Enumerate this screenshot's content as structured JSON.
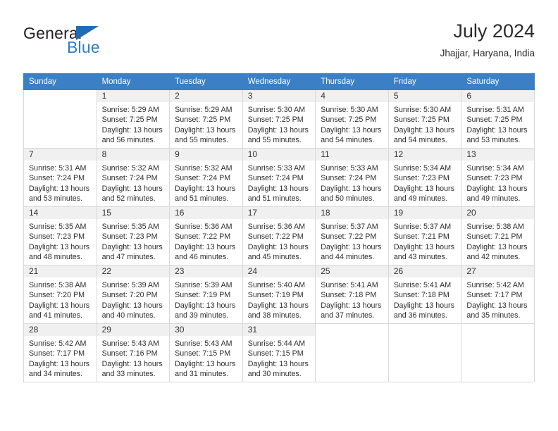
{
  "brand": {
    "line1": "General",
    "line2": "Blue",
    "triangle_color": "#1f6cb5",
    "blue_color": "#2e7dc4"
  },
  "header": {
    "title": "July 2024",
    "subtitle": "Jhajjar, Haryana, India"
  },
  "theme": {
    "header_bg": "#3b7fc4",
    "header_text": "#ffffff",
    "daynum_bg": "#f0f0f0",
    "grid_border": "#d8d8d8"
  },
  "weekdays": [
    "Sunday",
    "Monday",
    "Tuesday",
    "Wednesday",
    "Thursday",
    "Friday",
    "Saturday"
  ],
  "labels": {
    "sunrise_prefix": "Sunrise: ",
    "sunset_prefix": "Sunset: ",
    "daylight_prefix": "Daylight: "
  },
  "weeks": [
    [
      {
        "blank": true
      },
      {
        "day": "1",
        "sunrise": "Sunrise: 5:29 AM",
        "sunset": "Sunset: 7:25 PM",
        "daylight_a": "Daylight: 13 hours",
        "daylight_b": "and 56 minutes."
      },
      {
        "day": "2",
        "sunrise": "Sunrise: 5:29 AM",
        "sunset": "Sunset: 7:25 PM",
        "daylight_a": "Daylight: 13 hours",
        "daylight_b": "and 55 minutes."
      },
      {
        "day": "3",
        "sunrise": "Sunrise: 5:30 AM",
        "sunset": "Sunset: 7:25 PM",
        "daylight_a": "Daylight: 13 hours",
        "daylight_b": "and 55 minutes."
      },
      {
        "day": "4",
        "sunrise": "Sunrise: 5:30 AM",
        "sunset": "Sunset: 7:25 PM",
        "daylight_a": "Daylight: 13 hours",
        "daylight_b": "and 54 minutes."
      },
      {
        "day": "5",
        "sunrise": "Sunrise: 5:30 AM",
        "sunset": "Sunset: 7:25 PM",
        "daylight_a": "Daylight: 13 hours",
        "daylight_b": "and 54 minutes."
      },
      {
        "day": "6",
        "sunrise": "Sunrise: 5:31 AM",
        "sunset": "Sunset: 7:25 PM",
        "daylight_a": "Daylight: 13 hours",
        "daylight_b": "and 53 minutes."
      }
    ],
    [
      {
        "day": "7",
        "sunrise": "Sunrise: 5:31 AM",
        "sunset": "Sunset: 7:24 PM",
        "daylight_a": "Daylight: 13 hours",
        "daylight_b": "and 53 minutes."
      },
      {
        "day": "8",
        "sunrise": "Sunrise: 5:32 AM",
        "sunset": "Sunset: 7:24 PM",
        "daylight_a": "Daylight: 13 hours",
        "daylight_b": "and 52 minutes."
      },
      {
        "day": "9",
        "sunrise": "Sunrise: 5:32 AM",
        "sunset": "Sunset: 7:24 PM",
        "daylight_a": "Daylight: 13 hours",
        "daylight_b": "and 51 minutes."
      },
      {
        "day": "10",
        "sunrise": "Sunrise: 5:33 AM",
        "sunset": "Sunset: 7:24 PM",
        "daylight_a": "Daylight: 13 hours",
        "daylight_b": "and 51 minutes."
      },
      {
        "day": "11",
        "sunrise": "Sunrise: 5:33 AM",
        "sunset": "Sunset: 7:24 PM",
        "daylight_a": "Daylight: 13 hours",
        "daylight_b": "and 50 minutes."
      },
      {
        "day": "12",
        "sunrise": "Sunrise: 5:34 AM",
        "sunset": "Sunset: 7:23 PM",
        "daylight_a": "Daylight: 13 hours",
        "daylight_b": "and 49 minutes."
      },
      {
        "day": "13",
        "sunrise": "Sunrise: 5:34 AM",
        "sunset": "Sunset: 7:23 PM",
        "daylight_a": "Daylight: 13 hours",
        "daylight_b": "and 49 minutes."
      }
    ],
    [
      {
        "day": "14",
        "sunrise": "Sunrise: 5:35 AM",
        "sunset": "Sunset: 7:23 PM",
        "daylight_a": "Daylight: 13 hours",
        "daylight_b": "and 48 minutes."
      },
      {
        "day": "15",
        "sunrise": "Sunrise: 5:35 AM",
        "sunset": "Sunset: 7:23 PM",
        "daylight_a": "Daylight: 13 hours",
        "daylight_b": "and 47 minutes."
      },
      {
        "day": "16",
        "sunrise": "Sunrise: 5:36 AM",
        "sunset": "Sunset: 7:22 PM",
        "daylight_a": "Daylight: 13 hours",
        "daylight_b": "and 46 minutes."
      },
      {
        "day": "17",
        "sunrise": "Sunrise: 5:36 AM",
        "sunset": "Sunset: 7:22 PM",
        "daylight_a": "Daylight: 13 hours",
        "daylight_b": "and 45 minutes."
      },
      {
        "day": "18",
        "sunrise": "Sunrise: 5:37 AM",
        "sunset": "Sunset: 7:22 PM",
        "daylight_a": "Daylight: 13 hours",
        "daylight_b": "and 44 minutes."
      },
      {
        "day": "19",
        "sunrise": "Sunrise: 5:37 AM",
        "sunset": "Sunset: 7:21 PM",
        "daylight_a": "Daylight: 13 hours",
        "daylight_b": "and 43 minutes."
      },
      {
        "day": "20",
        "sunrise": "Sunrise: 5:38 AM",
        "sunset": "Sunset: 7:21 PM",
        "daylight_a": "Daylight: 13 hours",
        "daylight_b": "and 42 minutes."
      }
    ],
    [
      {
        "day": "21",
        "sunrise": "Sunrise: 5:38 AM",
        "sunset": "Sunset: 7:20 PM",
        "daylight_a": "Daylight: 13 hours",
        "daylight_b": "and 41 minutes."
      },
      {
        "day": "22",
        "sunrise": "Sunrise: 5:39 AM",
        "sunset": "Sunset: 7:20 PM",
        "daylight_a": "Daylight: 13 hours",
        "daylight_b": "and 40 minutes."
      },
      {
        "day": "23",
        "sunrise": "Sunrise: 5:39 AM",
        "sunset": "Sunset: 7:19 PM",
        "daylight_a": "Daylight: 13 hours",
        "daylight_b": "and 39 minutes."
      },
      {
        "day": "24",
        "sunrise": "Sunrise: 5:40 AM",
        "sunset": "Sunset: 7:19 PM",
        "daylight_a": "Daylight: 13 hours",
        "daylight_b": "and 38 minutes."
      },
      {
        "day": "25",
        "sunrise": "Sunrise: 5:41 AM",
        "sunset": "Sunset: 7:18 PM",
        "daylight_a": "Daylight: 13 hours",
        "daylight_b": "and 37 minutes."
      },
      {
        "day": "26",
        "sunrise": "Sunrise: 5:41 AM",
        "sunset": "Sunset: 7:18 PM",
        "daylight_a": "Daylight: 13 hours",
        "daylight_b": "and 36 minutes."
      },
      {
        "day": "27",
        "sunrise": "Sunrise: 5:42 AM",
        "sunset": "Sunset: 7:17 PM",
        "daylight_a": "Daylight: 13 hours",
        "daylight_b": "and 35 minutes."
      }
    ],
    [
      {
        "day": "28",
        "sunrise": "Sunrise: 5:42 AM",
        "sunset": "Sunset: 7:17 PM",
        "daylight_a": "Daylight: 13 hours",
        "daylight_b": "and 34 minutes."
      },
      {
        "day": "29",
        "sunrise": "Sunrise: 5:43 AM",
        "sunset": "Sunset: 7:16 PM",
        "daylight_a": "Daylight: 13 hours",
        "daylight_b": "and 33 minutes."
      },
      {
        "day": "30",
        "sunrise": "Sunrise: 5:43 AM",
        "sunset": "Sunset: 7:15 PM",
        "daylight_a": "Daylight: 13 hours",
        "daylight_b": "and 31 minutes."
      },
      {
        "day": "31",
        "sunrise": "Sunrise: 5:44 AM",
        "sunset": "Sunset: 7:15 PM",
        "daylight_a": "Daylight: 13 hours",
        "daylight_b": "and 30 minutes."
      },
      {
        "blank": true
      },
      {
        "blank": true
      },
      {
        "blank": true
      }
    ]
  ]
}
